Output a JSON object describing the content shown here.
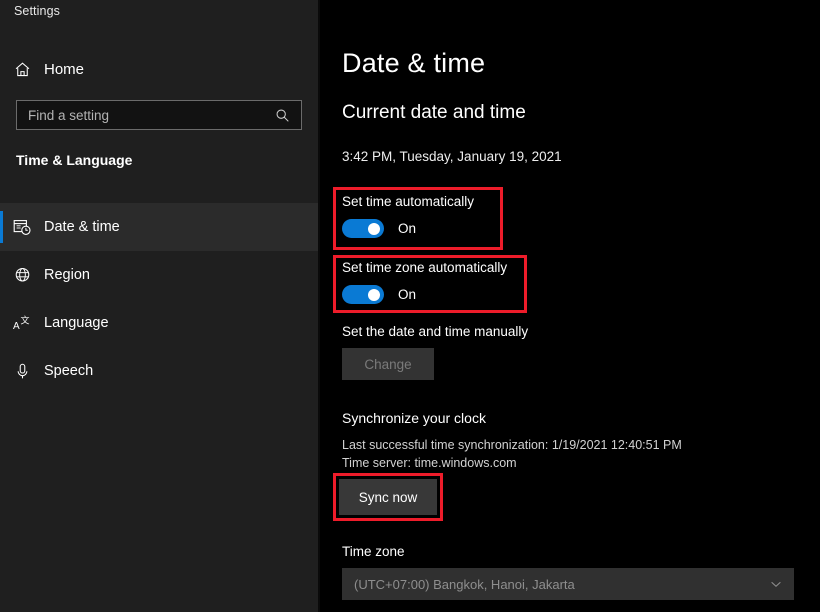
{
  "window": {
    "app_title": "Settings"
  },
  "sidebar": {
    "home": {
      "label": "Home",
      "icon": "home-icon"
    },
    "search": {
      "placeholder": "Find a setting",
      "value": "",
      "icon": "search-icon"
    },
    "section_title": "Time & Language",
    "items": [
      {
        "label": "Date & time",
        "icon": "calendar-clock-icon",
        "selected": true
      },
      {
        "label": "Region",
        "icon": "globe-icon",
        "selected": false
      },
      {
        "label": "Language",
        "icon": "language-icon",
        "selected": false
      },
      {
        "label": "Speech",
        "icon": "microphone-icon",
        "selected": false
      }
    ]
  },
  "main": {
    "page_title": "Date & time",
    "current_section_title": "Current date and time",
    "current_datetime": "3:42 PM, Tuesday, January 19, 2021",
    "set_time_automatically": {
      "label": "Set time automatically",
      "state": "On",
      "highlighted": true
    },
    "set_time_zone_automatically": {
      "label": "Set time zone automatically",
      "state": "On",
      "highlighted": true
    },
    "manual": {
      "label": "Set the date and time manually",
      "button_label": "Change",
      "button_enabled": false
    },
    "synchronize": {
      "title": "Synchronize your clock",
      "last_sync": "Last successful time synchronization: 1/19/2021 12:40:51 PM",
      "time_server": "Time server: time.windows.com",
      "button_label": "Sync now",
      "highlighted": true
    },
    "time_zone": {
      "label": "Time zone",
      "selected": "(UTC+07:00) Bangkok, Hanoi, Jakarta",
      "chevron_icon": "chevron-down-icon"
    }
  },
  "colors": {
    "accent_blue": "#0a7ad4",
    "highlight_red": "#ee1c2a",
    "sidebar_bg": "#1f1f1f",
    "content_bg": "#000000"
  }
}
